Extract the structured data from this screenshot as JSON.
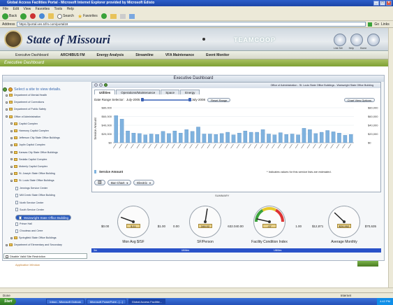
{
  "window": {
    "title": "Global Access Facilities Portal - Microsoft Internet Explorer provided by Microsoft Edisto"
  },
  "menu": [
    "File",
    "Edit",
    "View",
    "Favorites",
    "Tools",
    "Help"
  ],
  "toolbar": {
    "back": "Back",
    "search": "Search",
    "favorites": "Favorites"
  },
  "address": {
    "label": "Address",
    "url": "https://portal.ves.tcfm.com/portal18",
    "go": "Go",
    "links": "Links"
  },
  "site": {
    "title": "State of Missouri",
    "brand": "TEAMCOOP",
    "icons": [
      "Link Set",
      "Help",
      "Home"
    ]
  },
  "nav": [
    "Executive Dashboard",
    "ARCHIBUS FM",
    "Energy Analysis",
    "Streamline",
    "VFA Maintenance",
    "Event Monitor"
  ],
  "section": "Executive Dashboard",
  "panel": {
    "title": "Executive Dashboard",
    "tree_prompt": "Select a site to view details."
  },
  "tree": [
    {
      "label": "Department of Mental Health",
      "level": 0,
      "type": "folder"
    },
    {
      "label": "Department of Corrections",
      "level": 0,
      "type": "folder"
    },
    {
      "label": "Department of Public Safety",
      "level": 0,
      "type": "folder"
    },
    {
      "label": "Office of Administration",
      "level": 0,
      "type": "folder"
    },
    {
      "label": "Capitol Complex",
      "level": 1,
      "type": "folder"
    },
    {
      "label": "Harmony Capitol Complex",
      "level": 1,
      "type": "folder"
    },
    {
      "label": "Jefferson City State Office Buildings",
      "level": 1,
      "type": "folder"
    },
    {
      "label": "Joplin Capitol Complex",
      "level": 1,
      "type": "folder"
    },
    {
      "label": "Kansas City State Office Buildings",
      "level": 1,
      "type": "folder"
    },
    {
      "label": "Sedalia Capitol Complex",
      "level": 1,
      "type": "folder"
    },
    {
      "label": "Moberly Capitol Complex",
      "level": 1,
      "type": "folder"
    },
    {
      "label": "St. Joseph State Office Building",
      "level": 1,
      "type": "folder"
    },
    {
      "label": "St. Louis State Office Buildings",
      "level": 1,
      "type": "folder"
    },
    {
      "label": "Jennings Service Center",
      "level": 2,
      "type": "page"
    },
    {
      "label": "Mill Creek State Office Building",
      "level": 2,
      "type": "page"
    },
    {
      "label": "North Service Center",
      "level": 2,
      "type": "page"
    },
    {
      "label": "South Service Center",
      "level": 2,
      "type": "page"
    },
    {
      "label": "Wainwright State Office Building",
      "level": 2,
      "type": "page",
      "selected": true
    },
    {
      "label": "Prince Hall",
      "level": 2,
      "type": "page"
    },
    {
      "label": "Chouteau and Cerre",
      "level": 2,
      "type": "page"
    },
    {
      "label": "Springfield State Office Buildings",
      "level": 1,
      "type": "folder"
    },
    {
      "label": "Department of Elementary and Secondary",
      "level": 0,
      "type": "folder"
    }
  ],
  "disable_label": "Disable Valid Site Restriction",
  "chart_panel": {
    "breadcrumb": "Office of Administration - St. Louis State Office Buildings - Wainwright State Office Building",
    "tabs": [
      "Utilities",
      "Operations/Maintenance",
      "Space",
      "Energy"
    ],
    "range_label": "Date Range Selector:",
    "range_start": "July-2005",
    "range_end": "July-2008",
    "reset": "Reset Range",
    "view_options": "Chart View Options",
    "legend": "Service Amount",
    "note": "* Indicates values for this service lists are estimated.",
    "chart_type": "Bar Chart",
    "series_select": "Electric"
  },
  "chart_data": {
    "type": "bar",
    "ylabel": "Service Amount",
    "ylim": [
      0,
      80000
    ],
    "yticks": [
      "$80,000",
      "$60,000",
      "$40,000",
      "$20,000",
      "$0"
    ],
    "values": [
      62000,
      54000,
      27000,
      22000,
      21000,
      18000,
      20000,
      19000,
      26000,
      21000,
      27000,
      22000,
      30000,
      26000,
      36000,
      20000,
      20000,
      19000,
      21000,
      24000,
      18000,
      22000,
      27000,
      24000,
      24000,
      30000,
      20000,
      18000,
      23000,
      19000,
      20000,
      18000,
      33000,
      30000,
      21000,
      24000,
      28000,
      25000,
      22000,
      17000,
      19000
    ],
    "color": "#7fb2de"
  },
  "summary": {
    "label": "SUMMARY",
    "gauges": [
      {
        "label": "Mon Avg $/SF",
        "min": "$0.00",
        "max": "$1.00",
        "value": "$.11",
        "level": 0.11
      },
      {
        "label": "SF/Person",
        "min": "0.00",
        "max": "632.04",
        "value": "346.02",
        "level": 0.55
      },
      {
        "label": "Facility Condition Index",
        "min": "0.00",
        "max": "1.00",
        "value": ".07",
        "level": 0.07
      },
      {
        "label": "Average Monthly",
        "min": "$12,871",
        "max": "$70,635",
        "value": "$26,952",
        "level": 0.24
      }
    ]
  },
  "strip": [
    "3m",
    "Utilities",
    "Utilities"
  ],
  "footer": {
    "app_window": "Application Window",
    "status": "Done",
    "zone": "Internet"
  },
  "taskbar": {
    "start": "Start",
    "tasks": [
      "Inbox - Microsoft Outlook",
      "Microsoft PowerPoint - [...]",
      "Global Access Facilitie..."
    ],
    "clock": "4:42 PM"
  }
}
